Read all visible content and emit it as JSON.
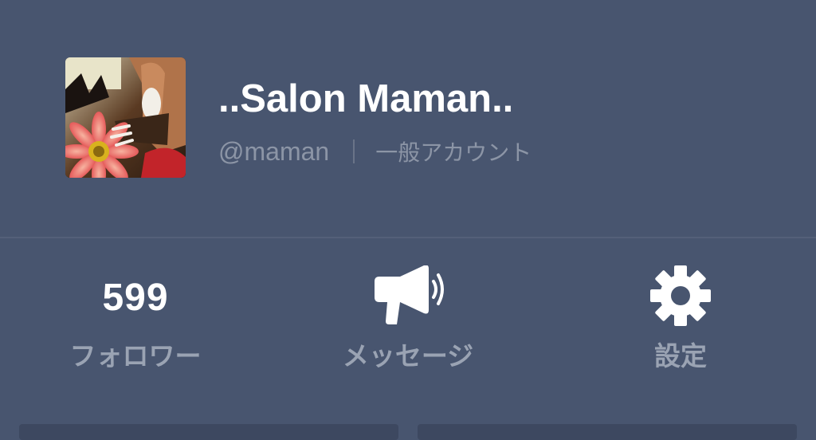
{
  "profile": {
    "name": "..Salon Maman..",
    "handle": "@maman",
    "account_type": "一般アカウント"
  },
  "actions": {
    "followers": {
      "count": "599",
      "label": "フォロワー"
    },
    "message": {
      "label": "メッセージ",
      "icon": "megaphone-icon"
    },
    "settings": {
      "label": "設定",
      "icon": "gear-icon"
    }
  },
  "colors": {
    "background": "#48556f",
    "primary_text": "#ffffff",
    "secondary_text": "#8c95a6"
  }
}
